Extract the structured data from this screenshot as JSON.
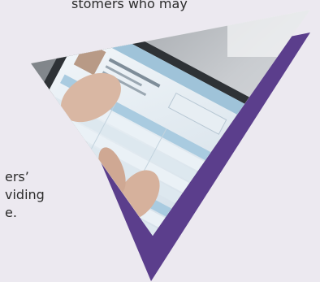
{
  "body_text": {
    "top_line": "stomers who may",
    "lines": [
      "ers’",
      "viding",
      "e."
    ]
  },
  "image": {
    "subject": "tablet-in-hands",
    "accent_color": "#5b3e8c",
    "screen_color": "#dbe7ef",
    "header_color": "#9fc3d9"
  }
}
